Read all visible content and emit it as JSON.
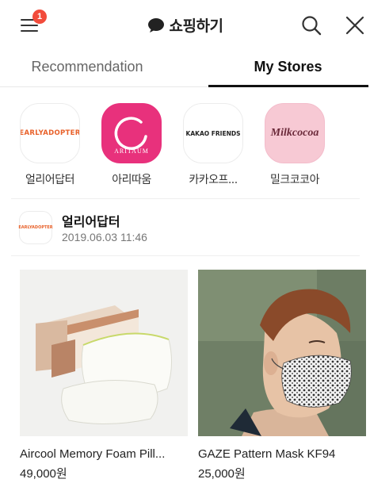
{
  "header": {
    "title": "쇼핑하기",
    "menu_badge": "1",
    "icons": {
      "menu": "menu-icon",
      "chat": "chat-bubble-icon",
      "search": "search-icon",
      "close": "close-icon"
    }
  },
  "tabs": [
    {
      "label": "Recommendation",
      "active": false
    },
    {
      "label": "My Stores",
      "active": true
    }
  ],
  "stores": [
    {
      "name": "얼리어답터",
      "logo_text": "EARLYADOPTER"
    },
    {
      "name": "아리따움",
      "logo_text": "ARITAUM"
    },
    {
      "name": "카카오프...",
      "logo_text": "KAKAO FRIENDS"
    },
    {
      "name": "밀크코코아",
      "logo_text": "Milkcocoa"
    }
  ],
  "feed": {
    "store_name": "얼리어답터",
    "logo_text": "EARLYADOPTER",
    "timestamp": "2019.06.03 11:46"
  },
  "products": [
    {
      "name": "Aircool Memory Foam Pill...",
      "price": "49,000원"
    },
    {
      "name": "GAZE Pattern Mask KF94",
      "price": "25,000원"
    }
  ],
  "colors": {
    "badge": "#f24b3b",
    "aritaum_pink": "#e8317c",
    "milkcocoa_pink": "#f7c9d4",
    "active_tab": "#111111",
    "inactive_tab": "#666666"
  }
}
